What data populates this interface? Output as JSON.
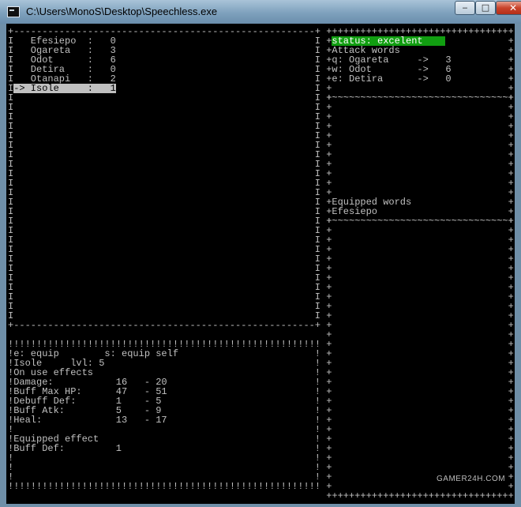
{
  "window": {
    "title": "C:\\Users\\MonoS\\Desktop\\Speechless.exe",
    "minimize": "‒",
    "maximize": "□",
    "close": "✕"
  },
  "word_list": {
    "items": [
      {
        "name": "Efesiepo",
        "value": "0"
      },
      {
        "name": "Ogareta",
        "value": "3"
      },
      {
        "name": "Odot",
        "value": "6"
      },
      {
        "name": "Detira",
        "value": "0"
      },
      {
        "name": "Otanapi",
        "value": "2"
      },
      {
        "name": "Isole",
        "value": "1"
      }
    ],
    "cursor": "->",
    "selected_index": 5
  },
  "detail": {
    "commands": "e: equip        s: equip self",
    "word": "Isole",
    "level": "lvl: 5",
    "on_use_heading": "On use effects",
    "effects": [
      {
        "name": "Damage:",
        "min": "16",
        "max": "20"
      },
      {
        "name": "Buff Max HP:",
        "min": "47",
        "max": "51"
      },
      {
        "name": "Debuff Def:",
        "min": "1",
        "max": "5"
      },
      {
        "name": "Buff Atk:",
        "min": "5",
        "max": "9"
      },
      {
        "name": "Heal:",
        "min": "13",
        "max": "17"
      }
    ],
    "equipped_heading": "Equipped effect",
    "equipped_effect": {
      "name": "Buff Def:",
      "value": "1"
    }
  },
  "side": {
    "status": "status: excelent",
    "attack_heading": "Attack words",
    "attack": [
      {
        "key": "q:",
        "name": "Ogareta",
        "arrow": "->",
        "value": "3"
      },
      {
        "key": "w:",
        "name": "Odot",
        "arrow": "->",
        "value": "6"
      },
      {
        "key": "e:",
        "name": "Detira",
        "arrow": "->",
        "value": "0"
      }
    ],
    "equipped_heading": "Equipped words",
    "equipped": [
      "Efesiepo"
    ]
  },
  "watermark": "GAMER24H.COM",
  "colors": {
    "status_bg": "#119e11",
    "text": "#c0c0c0",
    "highlight": "#c0c0c0"
  }
}
